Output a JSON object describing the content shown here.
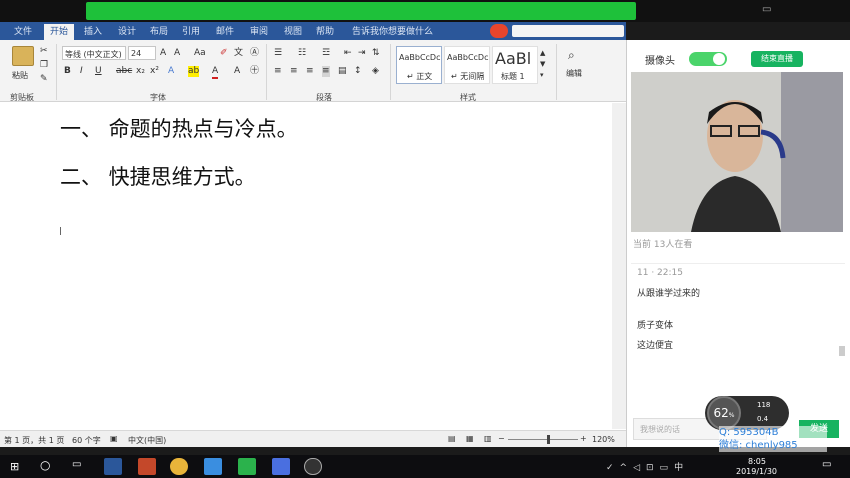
{
  "word": {
    "tabs": [
      "文件",
      "开始",
      "插入",
      "设计",
      "布局",
      "引用",
      "邮件",
      "审阅",
      "视图",
      "帮助",
      "告诉我你想要做什么"
    ],
    "active_tab": "开始",
    "clipboard": {
      "paste_label": "粘贴",
      "group_label": "剪贴板"
    },
    "font": {
      "name": "等线 (中文正文)",
      "size": "24",
      "group_label": "字体"
    },
    "paragraph": {
      "group_label": "段落"
    },
    "styles": {
      "group_label": "样式",
      "items": [
        {
          "preview": "AaBbCcDc",
          "name": "↵ 正文"
        },
        {
          "preview": "AaBbCcDc",
          "name": "↵ 无间隔"
        },
        {
          "preview": "AaBl",
          "name": "标题 1"
        }
      ]
    },
    "editing": {
      "label": "编辑"
    },
    "document": {
      "lines": [
        "一、 命题的热点与冷点。",
        "二、 快捷思维方式。"
      ]
    },
    "status": {
      "page": "第 1 页，共 1 页",
      "words": "60 个字",
      "language": "中文(中国)",
      "zoom": "120%",
      "zoom_level": 0.55
    }
  },
  "live": {
    "camera_label": "摄像头",
    "end_button": "结束直播",
    "viewers": "当前 13人在看",
    "chat": [
      {
        "text": "11 · 22:15",
        "meta": true
      },
      {
        "text": "从跟谁学过来的",
        "meta": false
      },
      {
        "text": "质子变体",
        "meta": false
      },
      {
        "text": "这边便宜",
        "meta": false
      }
    ],
    "input_placeholder": "我想说的话",
    "send_button": "发送",
    "network": {
      "percent": "62",
      "unit": "%",
      "up": "118",
      "down": "0.4"
    },
    "watermark": {
      "line1": "Q: 595304B",
      "line2": "微信: chenly985"
    }
  },
  "taskbar": {
    "time": "8:05",
    "date": "2019/1/30"
  },
  "colors": {
    "word_blue": "#2b579a",
    "live_green": "#17b360",
    "banner_green": "#1ec13a"
  }
}
